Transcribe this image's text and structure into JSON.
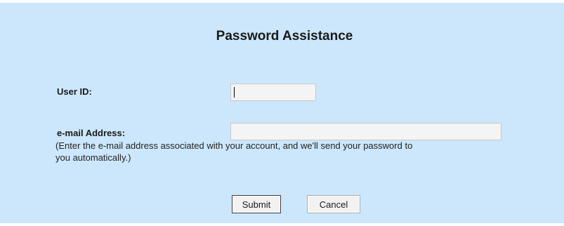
{
  "title": "Password Assistance",
  "form": {
    "user_id": {
      "label": "User ID:",
      "value": ""
    },
    "email": {
      "label": "e-mail Address:",
      "value": "",
      "help": "(Enter the e-mail address associated with your account, and we'll send your password to\nyou automatically.)"
    }
  },
  "buttons": {
    "submit": "Submit",
    "cancel": "Cancel"
  },
  "colors": {
    "background": "#cce7fb",
    "field": "#f4f4f4"
  }
}
